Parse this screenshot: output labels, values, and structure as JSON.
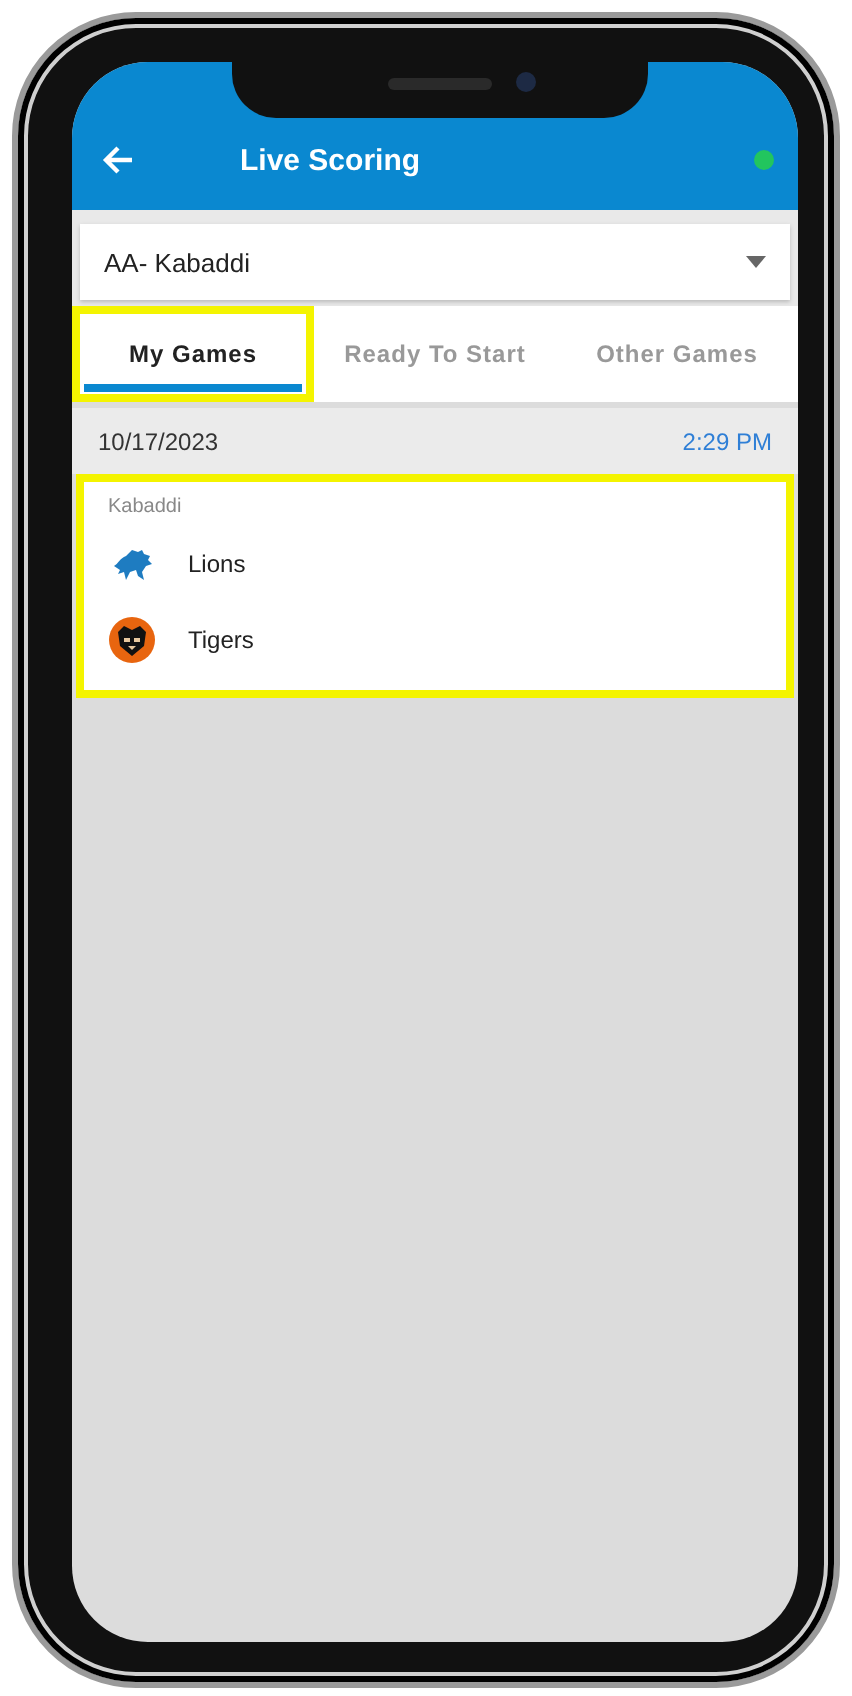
{
  "header": {
    "title": "Live Scoring",
    "online": true
  },
  "league_select": {
    "value": "AA- Kabaddi"
  },
  "tabs": [
    {
      "label": "My Games",
      "selected": true,
      "highlighted": true
    },
    {
      "label": "Ready To Start",
      "selected": false,
      "highlighted": false
    },
    {
      "label": "Other Games",
      "selected": false,
      "highlighted": false
    }
  ],
  "games": [
    {
      "date": "10/17/2023",
      "time": "2:29 PM",
      "sport": "Kabaddi",
      "highlighted": true,
      "teams": [
        {
          "name": "Lions",
          "kind": "lion"
        },
        {
          "name": "Tigers",
          "kind": "tiger"
        }
      ]
    }
  ]
}
